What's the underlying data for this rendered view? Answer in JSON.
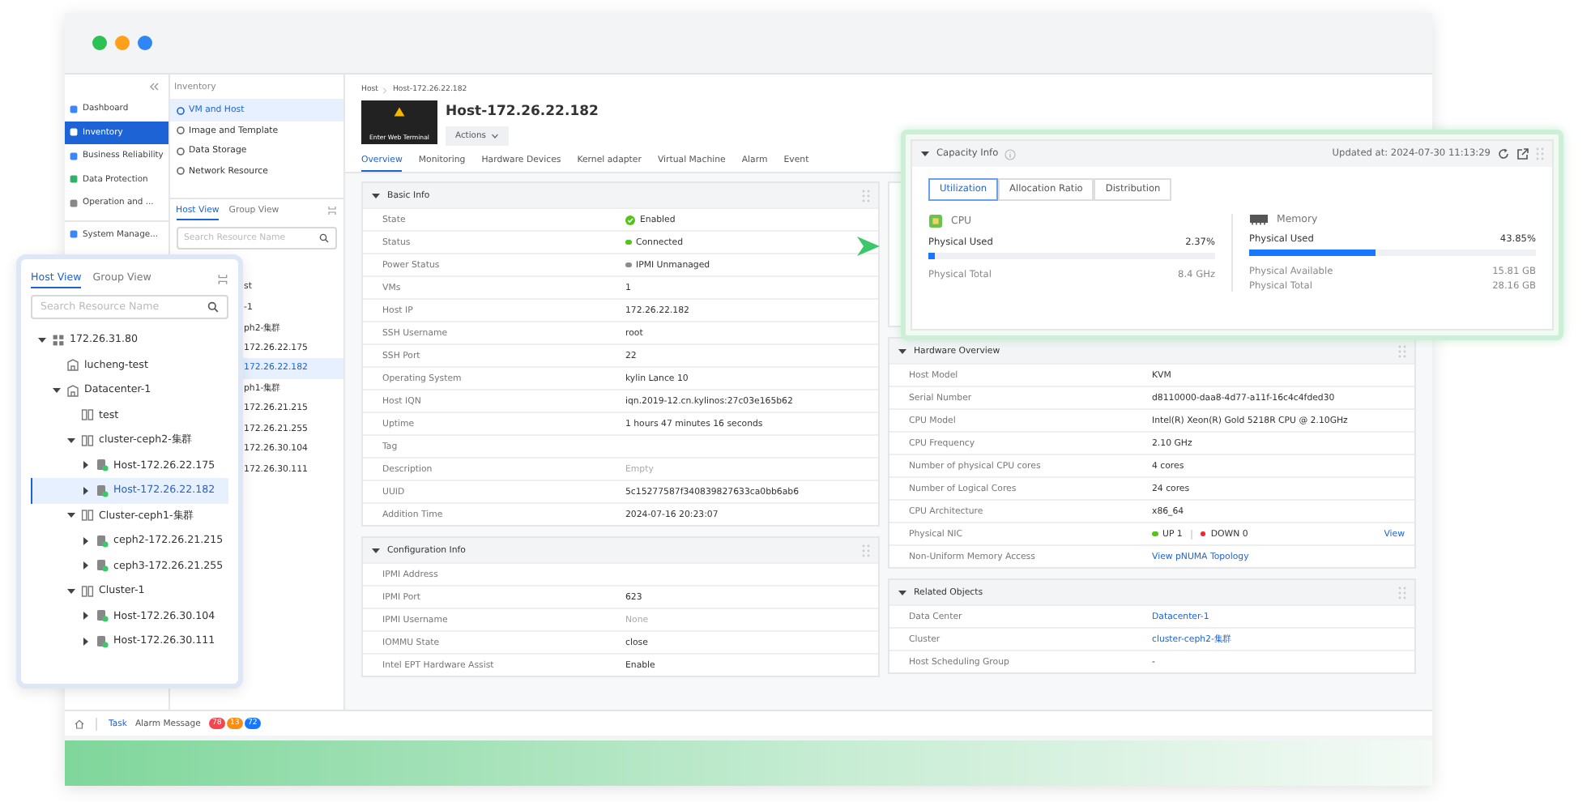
{
  "nav": {
    "items": [
      {
        "label": "Dashboard",
        "selected": false
      },
      {
        "label": "Inventory",
        "selected": true
      },
      {
        "label": "Business Reliability",
        "selected": false
      },
      {
        "label": "Data Protection",
        "selected": false
      },
      {
        "label": "Operation and ...",
        "selected": false
      },
      {
        "label": "System Manage...",
        "selected": false
      }
    ]
  },
  "inventory": {
    "title": "Inventory",
    "items": [
      {
        "label": "VM and Host",
        "selected": true
      },
      {
        "label": "Image and Template",
        "selected": false
      },
      {
        "label": "Data Storage",
        "selected": false
      },
      {
        "label": "Network Resource",
        "selected": false
      }
    ],
    "tabs": [
      {
        "label": "Host View",
        "selected": true
      },
      {
        "label": "Group View",
        "selected": false
      }
    ],
    "search_placeholder": "Search Resource Name",
    "tree_fragments": [
      {
        "label": "st",
        "selected": false
      },
      {
        "label": "-1",
        "selected": false
      },
      {
        "label": "ph2-集群",
        "selected": false
      },
      {
        "label": "172.26.22.175",
        "selected": false
      },
      {
        "label": "172.26.22.182",
        "selected": true
      },
      {
        "label": "ph1-集群",
        "selected": false
      },
      {
        "label": "172.26.21.215",
        "selected": false
      },
      {
        "label": "172.26.21.255",
        "selected": false
      },
      {
        "label": "172.26.30.104",
        "selected": false
      },
      {
        "label": "172.26.30.111",
        "selected": false
      }
    ]
  },
  "breadcrumb": [
    "Host",
    "Host-172.26.22.182"
  ],
  "terminal": {
    "label": "Enter Web Terminal"
  },
  "title": "Host-172.26.22.182",
  "actions": "Actions",
  "tabs": [
    {
      "label": "Overview",
      "selected": true
    },
    {
      "label": "Monitoring",
      "selected": false
    },
    {
      "label": "Hardware Devices",
      "selected": false
    },
    {
      "label": "Kernel adapter",
      "selected": false
    },
    {
      "label": "Virtual Machine",
      "selected": false
    },
    {
      "label": "Alarm",
      "selected": false
    },
    {
      "label": "Event",
      "selected": false
    }
  ],
  "basic_info": {
    "title": "Basic Info",
    "expanded": true,
    "rows": [
      {
        "label": "State",
        "kind": "check",
        "value": "Enabled"
      },
      {
        "label": "Status",
        "kind": "dot",
        "color": "#52c41a",
        "value": "Connected"
      },
      {
        "label": "Power Status",
        "kind": "dot",
        "color": "#8c8c8c",
        "value": "IPMI Unmanaged"
      },
      {
        "label": "VMs",
        "kind": "text",
        "value": "1"
      },
      {
        "label": "Host IP",
        "kind": "text",
        "value": "172.26.22.182"
      },
      {
        "label": "SSH Username",
        "kind": "text",
        "value": "root"
      },
      {
        "label": "SSH Port",
        "kind": "text",
        "value": "22"
      },
      {
        "label": "Operating System",
        "kind": "text",
        "value": "kylin Lance 10"
      },
      {
        "label": "Host IQN",
        "kind": "text",
        "value": "iqn.2019-12.cn.kylinos:27c03e165b62"
      },
      {
        "label": "Uptime",
        "kind": "text",
        "value": "1 hours 47 minutes 16 seconds"
      },
      {
        "label": "Tag",
        "kind": "text"
      },
      {
        "label": "Description",
        "kind": "empty",
        "value": "Empty"
      },
      {
        "label": "UUID",
        "kind": "text",
        "value": "5c15277587f340839827633ca0bb6ab6"
      },
      {
        "label": "Addition Time",
        "kind": "text",
        "value": "2024-07-16 20:23:07"
      }
    ]
  },
  "configuration_info": {
    "title": "Configuration Info",
    "expanded": true,
    "rows": [
      {
        "label": "IPMI Address",
        "kind": "text"
      },
      {
        "label": "IPMI Port",
        "kind": "text",
        "value": "623"
      },
      {
        "label": "IPMI Username",
        "kind": "empty",
        "value": "None"
      },
      {
        "label": "IOMMU State",
        "kind": "text",
        "value": "close"
      },
      {
        "label": "Intel EPT Hardware Assist",
        "kind": "text",
        "value": "Enable"
      }
    ]
  },
  "hardware_overview": {
    "title": "Hardware Overview",
    "expanded": true,
    "rows": [
      {
        "label": "Host Model",
        "kind": "text",
        "value": "KVM"
      },
      {
        "label": "Serial Number",
        "kind": "text",
        "value": "d8110000-daa8-4d77-a11f-16c4c4fded30"
      },
      {
        "label": "CPU Model",
        "kind": "text",
        "value": "Intel(R) Xeon(R) Gold 5218R CPU @ 2.10GHz"
      },
      {
        "label": "CPU Frequency",
        "kind": "text",
        "value": "2.10 GHz"
      },
      {
        "label": "Number of physical CPU cores",
        "kind": "text",
        "value": "4 cores"
      },
      {
        "label": "Number of Logical Cores",
        "kind": "text",
        "value": "24 cores"
      },
      {
        "label": "CPU Architecture",
        "kind": "text",
        "value": "x86_64"
      },
      {
        "label": "Physical NIC",
        "kind": "nic",
        "items": [
          {
            "text": "UP 1",
            "color": "#52c41a"
          },
          {
            "text": "DOWN 0",
            "color": "#f5222d"
          }
        ],
        "action": "View"
      },
      {
        "label": "Non-Uniform Memory Access",
        "kind": "link",
        "value": "View pNUMA Topology"
      }
    ]
  },
  "related_objects": {
    "title": "Related Objects",
    "expanded": true,
    "rows": [
      {
        "label": "Data Center",
        "kind": "link",
        "value": "Datacenter-1"
      },
      {
        "label": "Cluster",
        "kind": "link",
        "value": "cluster-ceph2-集群"
      },
      {
        "label": "Host Scheduling Group",
        "kind": "text",
        "value": "-"
      }
    ]
  },
  "status_bar": {
    "items": [
      {
        "label": "Task",
        "selected": true
      },
      {
        "label": "Alarm Message",
        "selected": false
      }
    ],
    "badges": [
      {
        "text": "78",
        "color": "#f5454f"
      },
      {
        "text": "13",
        "color": "#fa8c16"
      },
      {
        "text": "72",
        "color": "#1677ff"
      }
    ]
  },
  "capacity": {
    "title": "Capacity Info",
    "expanded": true,
    "updated": "Updated at: 2024-07-30 11:13:29",
    "tabs": [
      {
        "label": "Utilization",
        "selected": true
      },
      {
        "label": "Allocation Ratio",
        "selected": false
      },
      {
        "label": "Distribution",
        "selected": false
      }
    ],
    "resources": [
      {
        "kind": "cpu",
        "title": "CPU",
        "used_label": "Physical Used",
        "used": "2.37%",
        "level": 0.0237,
        "details": [
          {
            "label": "Physical Total",
            "value": "8.4 GHz"
          }
        ]
      },
      {
        "kind": "memory",
        "title": "Memory",
        "used_label": "Physical Used",
        "used": "43.85%",
        "level": 0.4385,
        "details": [
          {
            "label": "Physical Available",
            "value": "15.81 GB"
          },
          {
            "label": "Physical Total",
            "value": "28.16 GB"
          }
        ]
      }
    ]
  },
  "tree_panel": {
    "tabs": [
      {
        "label": "Host View",
        "selected": true
      },
      {
        "label": "Group View",
        "selected": false
      }
    ],
    "search_placeholder": "Search Resource Name",
    "tree": [
      {
        "label": "172.26.31.80",
        "kind": "vcenter",
        "expanded": true,
        "selected": false,
        "children": [
          {
            "label": "lucheng-test",
            "kind": "datacenter",
            "selected": false
          },
          {
            "label": "Datacenter-1",
            "kind": "datacenter",
            "expanded": true,
            "selected": false,
            "children": [
              {
                "label": "test",
                "kind": "cluster",
                "selected": false
              },
              {
                "label": "cluster-ceph2-集群",
                "kind": "cluster",
                "expanded": true,
                "selected": false,
                "children": [
                  {
                    "label": "Host-172.26.22.175",
                    "kind": "host",
                    "expanded": false,
                    "selected": false
                  },
                  {
                    "label": "Host-172.26.22.182",
                    "kind": "host",
                    "expanded": false,
                    "selected": true
                  }
                ]
              },
              {
                "label": "Cluster-ceph1-集群",
                "kind": "cluster",
                "expanded": true,
                "selected": false,
                "children": [
                  {
                    "label": "ceph2-172.26.21.215",
                    "kind": "host",
                    "expanded": false,
                    "selected": false
                  },
                  {
                    "label": "ceph3-172.26.21.255",
                    "kind": "host",
                    "expanded": false,
                    "selected": false
                  }
                ]
              },
              {
                "label": "Cluster-1",
                "kind": "cluster",
                "expanded": true,
                "selected": false,
                "children": [
                  {
                    "label": "Host-172.26.30.104",
                    "kind": "host",
                    "expanded": false,
                    "selected": false
                  },
                  {
                    "label": "Host-172.26.30.111",
                    "kind": "host",
                    "expanded": false,
                    "selected": false
                  }
                ]
              }
            ]
          }
        ]
      }
    ]
  }
}
